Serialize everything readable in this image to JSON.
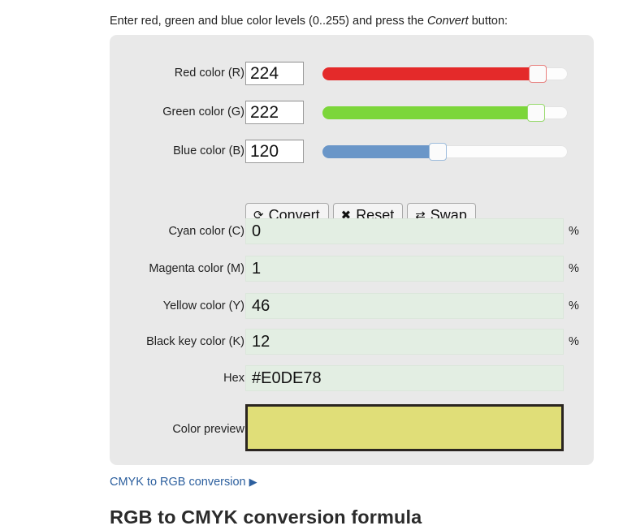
{
  "intro": {
    "prefix": "Enter red, green and blue color levels (0..255) and press the ",
    "emphasis": "Convert",
    "suffix": " button:"
  },
  "inputs": [
    {
      "label": "Red color (R):",
      "value": "224",
      "name": "red",
      "max": 255,
      "fill_color": "#e42a2a",
      "thumb_border": "#e8807e"
    },
    {
      "label": "Green color (G):",
      "value": "222",
      "name": "green",
      "max": 255,
      "fill_color": "#7cd63a",
      "thumb_border": "#96d96a"
    },
    {
      "label": "Blue color (B):",
      "value": "120",
      "name": "blue",
      "max": 255,
      "fill_color": "#6a96c8",
      "thumb_border": "#9dbcdc"
    }
  ],
  "buttons": [
    {
      "icon": "refresh-icon",
      "glyph": "⟳",
      "label": "Convert",
      "name": "convert"
    },
    {
      "icon": "cross-icon",
      "glyph": "✖",
      "label": "Reset",
      "name": "reset"
    },
    {
      "icon": "swap-icon",
      "glyph": "⇄",
      "label": "Swap",
      "name": "swap"
    }
  ],
  "outputs": [
    {
      "label": "Cyan color (C):",
      "value": "0",
      "unit": "%",
      "name": "cyan"
    },
    {
      "label": "Magenta color (M):",
      "value": "1",
      "unit": "%",
      "name": "magenta"
    },
    {
      "label": "Yellow color (Y):",
      "value": "46",
      "unit": "%",
      "name": "yellow"
    },
    {
      "label": "Black key color (K):",
      "value": "12",
      "unit": "%",
      "name": "black-key"
    }
  ],
  "hex": {
    "label": "Hex:",
    "value": "#E0DE78"
  },
  "preview": {
    "label": "Color preview:",
    "color": "#E0DE78"
  },
  "footer": {
    "link_text": "CMYK to RGB conversion",
    "link_arrow": "▶",
    "heading": "RGB to CMYK conversion formula"
  },
  "colors": {
    "panel_bg": "#e9e9e9",
    "readonly_bg": "#e3eee3",
    "link": "#2c5f9e"
  }
}
